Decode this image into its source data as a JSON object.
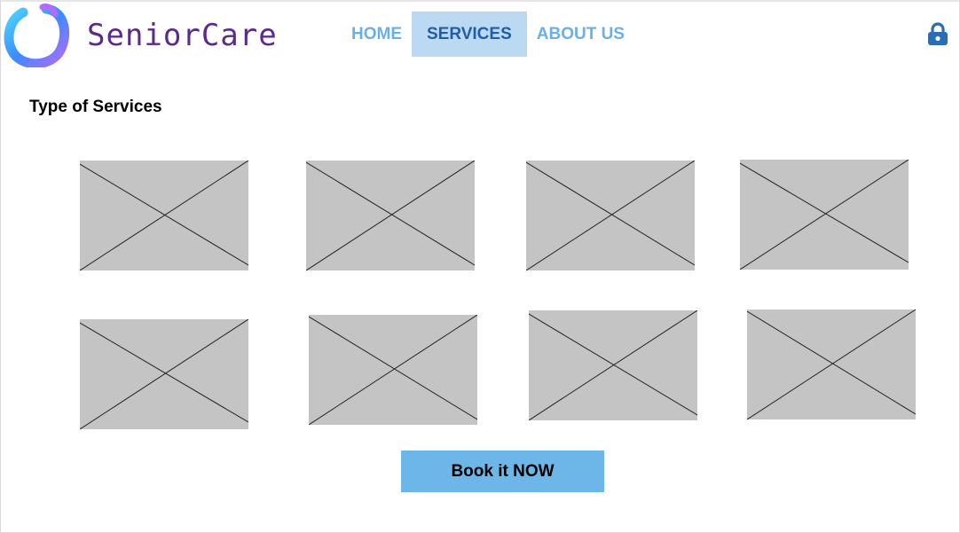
{
  "header": {
    "brand": "SeniorCare",
    "logo_icon": "ring-logo-icon",
    "nav": [
      {
        "label": "HOME",
        "active": false
      },
      {
        "label": "SERVICES",
        "active": true
      },
      {
        "label": "ABOUT US",
        "active": false
      }
    ],
    "lock_icon": "lock-icon"
  },
  "main": {
    "section_title": "Type of Services",
    "service_images": [
      "image-placeholder",
      "image-placeholder",
      "image-placeholder",
      "image-placeholder",
      "image-placeholder",
      "image-placeholder",
      "image-placeholder",
      "image-placeholder"
    ],
    "cta_label": "Book it NOW"
  },
  "colors": {
    "nav_inactive": "#6ab0e8",
    "nav_active_bg": "#bcd9f3",
    "nav_active_text": "#1f5ea8",
    "button_bg": "#6db6e8",
    "placeholder": "#c4c4c4",
    "brand_text": "#5c2a8a",
    "lock": "#2a6db5"
  }
}
